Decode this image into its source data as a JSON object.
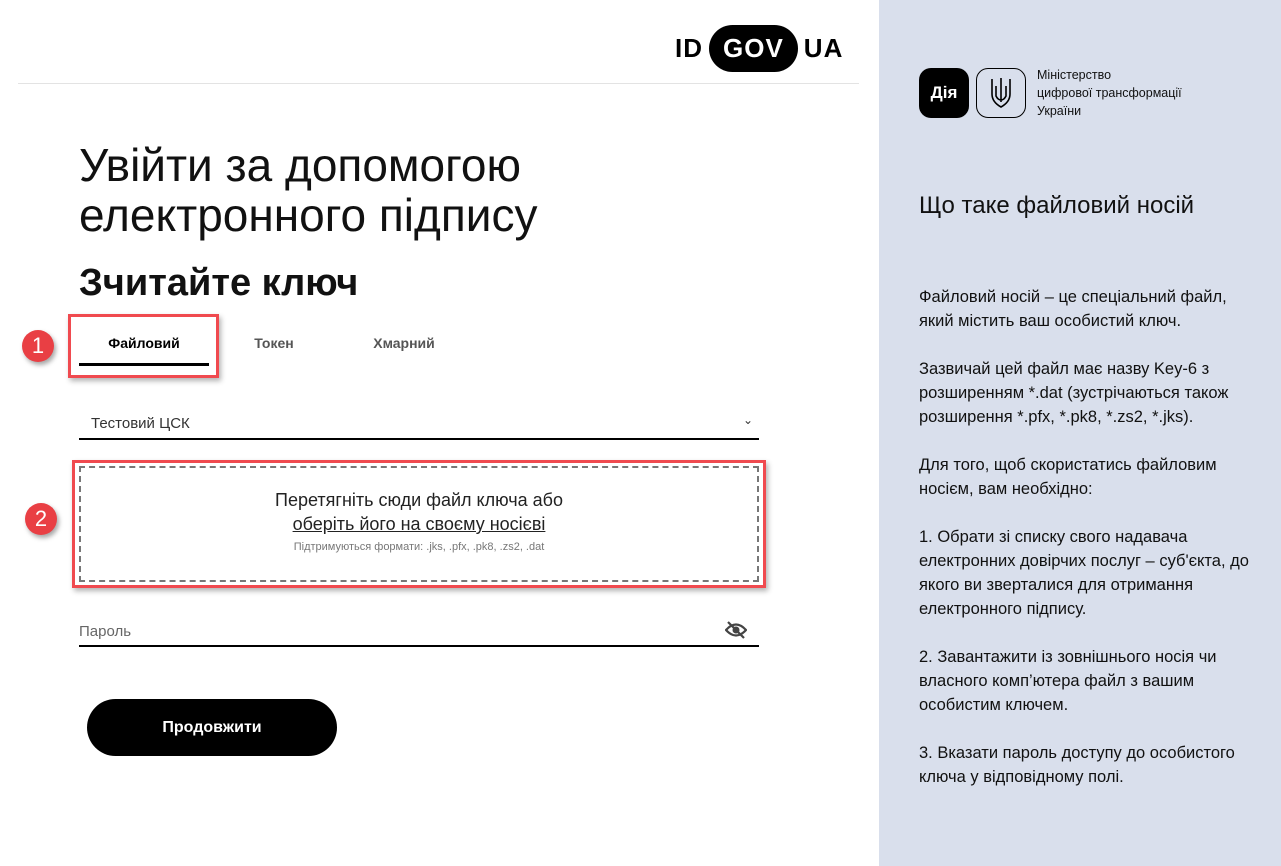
{
  "logo": {
    "id": "ID",
    "gov": "GOV",
    "ua": "UA"
  },
  "title": "Увійти за допомогою електронного підпису",
  "subtitle": "Зчитайте ключ",
  "tabs": [
    {
      "label": "Файловий",
      "active": true
    },
    {
      "label": "Токен"
    },
    {
      "label": "Хмарний"
    }
  ],
  "annotations": [
    "1",
    "2"
  ],
  "annotation_color": "#e93f44",
  "select": {
    "value": "Тестовий ЦСК"
  },
  "dropzone": {
    "line1": "Перетягніть сюди файл ключа або",
    "link": "оберіть його на своєму носієві",
    "formats": "Підтримуються формати: .jks, .pfx, .pk8, .zs2, .dat"
  },
  "password": {
    "placeholder": "Пароль",
    "icon": "eye-off-icon"
  },
  "submit": "Продовжити",
  "sidebar": {
    "diia": "Дія",
    "ministry": [
      "Міністерство",
      "цифрової трансформації",
      "України"
    ],
    "title": "Що таке файловий носій",
    "paragraphs": [
      "Файловий носій – це спеціальний файл, який містить ваш особистий ключ.",
      "Зазвичай цей файл має назву Key-6 з розширенням *.dat (зустрічаються також розширення *.pfx, *.pk8, *.zs2, *.jks).",
      "Для того, щоб скористатись файловим носієм, вам необхідно:",
      "1. Обрати зі списку свого надавача електронних довірчих послуг – суб'єкта, до якого ви зверталися для отримання електронного підпису.",
      "2. Завантажити із зовнішнього носія чи власного комп’ютера файл з вашим особистим ключем.",
      "3. Вказати пароль доступу до особистого ключа у відповідному полі."
    ]
  }
}
